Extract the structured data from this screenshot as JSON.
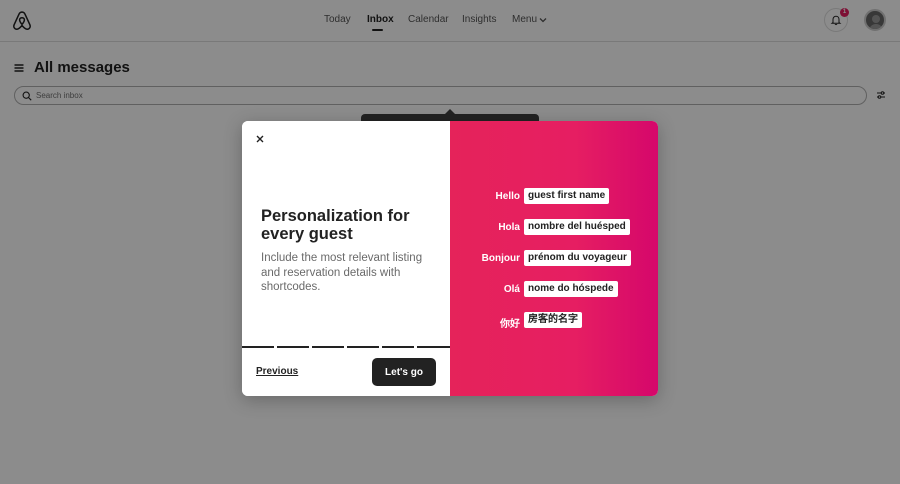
{
  "nav": {
    "items": [
      {
        "label": "Today"
      },
      {
        "label": "Inbox"
      },
      {
        "label": "Calendar"
      },
      {
        "label": "Insights"
      },
      {
        "label": "Menu"
      }
    ],
    "active": "Inbox",
    "notification_count": "1"
  },
  "page": {
    "title": "All messages",
    "search_placeholder": "Search inbox"
  },
  "modal": {
    "title": "Personalization for every guest",
    "body": "Include the most relevant listing and reservation details with shortcodes.",
    "previous_label": "Previous",
    "primary_label": "Let's go",
    "progress": {
      "total_steps": 6,
      "current_step": 6
    },
    "examples": [
      {
        "greeting": "Hello",
        "shortcode": "guest first name"
      },
      {
        "greeting": "Hola",
        "shortcode": "nombre del huésped"
      },
      {
        "greeting": "Bonjour",
        "shortcode": "prénom du voyageur"
      },
      {
        "greeting": "Olá",
        "shortcode": "nome do hóspede"
      },
      {
        "greeting": "你好",
        "shortcode": "房客的名字"
      }
    ]
  },
  "colors": {
    "brand": "#FF385C",
    "gradient_start": "#E5235A",
    "gradient_end": "#D5076B",
    "badge": "#E31C5F",
    "primary_button": "#222222"
  }
}
